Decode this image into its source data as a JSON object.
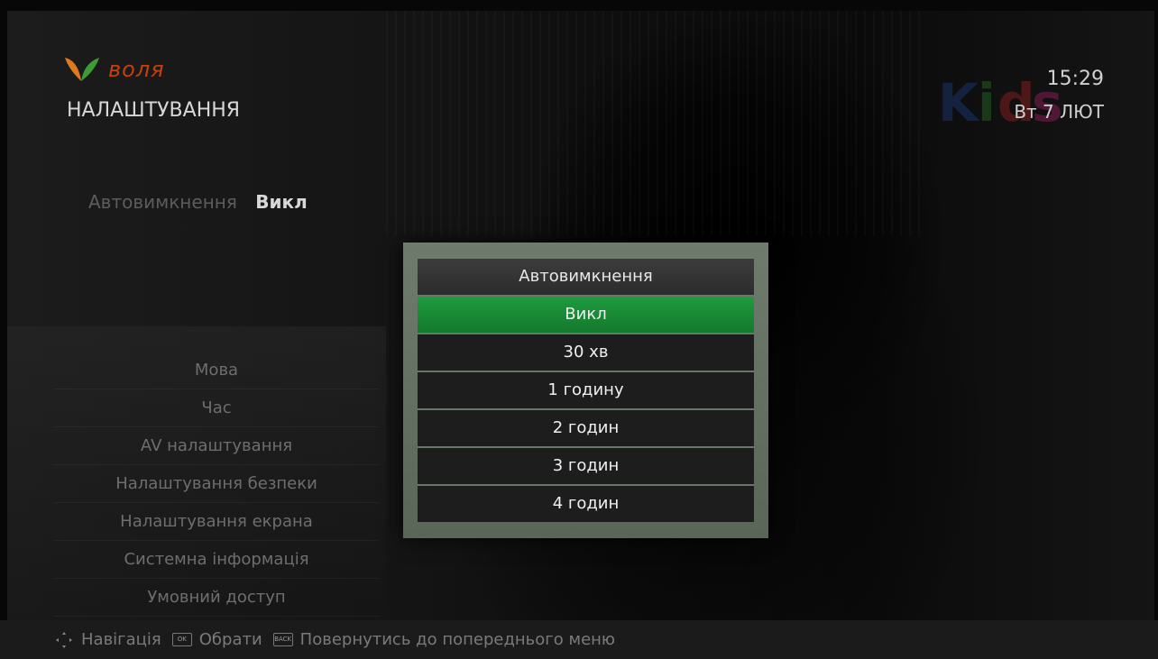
{
  "brand": {
    "name": "воля",
    "color": "#c2410c"
  },
  "header": {
    "title": "НАЛАШТУВАННЯ",
    "time": "15:29",
    "date": "Вт 7 ЛЮТ"
  },
  "setting": {
    "label": "Автовимкнення",
    "value": "Викл"
  },
  "menu": {
    "items": [
      {
        "label": "Мова"
      },
      {
        "label": "Час"
      },
      {
        "label": "AV налаштування"
      },
      {
        "label": "Налаштування безпеки"
      },
      {
        "label": "Налаштування екрана"
      },
      {
        "label": "Системна інформація"
      },
      {
        "label": "Умовний доступ"
      }
    ]
  },
  "dialog": {
    "title": "Автовимкнення",
    "options": [
      {
        "label": "Викл",
        "selected": true
      },
      {
        "label": "30 хв"
      },
      {
        "label": "1 годину"
      },
      {
        "label": "2 годин"
      },
      {
        "label": "3 годин"
      },
      {
        "label": "4 годин"
      }
    ],
    "accent": "#1f9a3f"
  },
  "footer": {
    "nav_label": "Навігація",
    "ok_key": "OK",
    "ok_label": "Обрати",
    "back_key": "BACK",
    "back_label": "Повернутись до попереднього меню"
  },
  "icons": [
    "dpad-icon",
    "ok-key-icon",
    "back-key-icon",
    "brand-logo-icon",
    "channel-logo-icon"
  ]
}
